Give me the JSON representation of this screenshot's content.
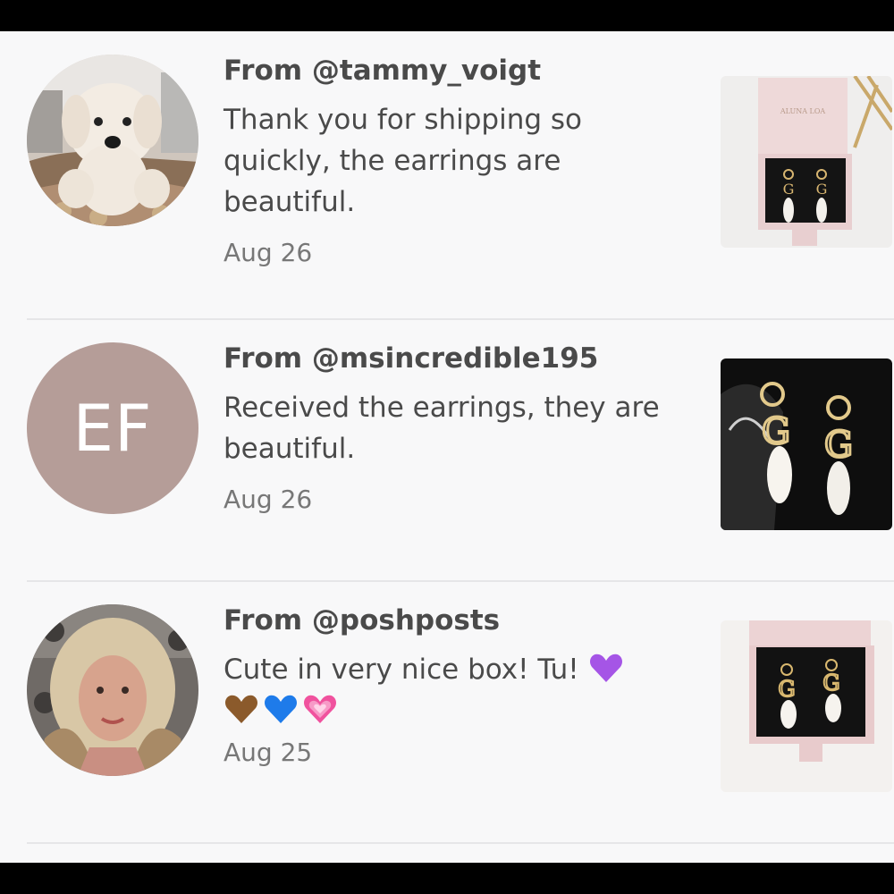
{
  "feedback": [
    {
      "from": "From @tammy_voigt",
      "message": "Thank you for shipping so quickly, the earrings are beautiful.",
      "date": "Aug 26",
      "avatar": "dog-photo",
      "thumbnail": "earrings-pink-box-photo",
      "thumbnail_text": "ALUNA LOA"
    },
    {
      "from": "From @msincredible195",
      "message": "Received the earrings, they are beautiful.",
      "date": "Aug 26",
      "avatar_initials": "EF",
      "avatar_color": "#b59d98",
      "thumbnail": "earrings-black-background-photo"
    },
    {
      "from": "From @poshposts",
      "message": "Cute in very nice box! Tu! ",
      "emojis": [
        "purple-heart-icon",
        "brown-heart-icon",
        "blue-heart-icon",
        "growing-heart-icon"
      ],
      "date": "Aug 25",
      "avatar": "woman-photo",
      "thumbnail": "earrings-box-photo"
    }
  ]
}
